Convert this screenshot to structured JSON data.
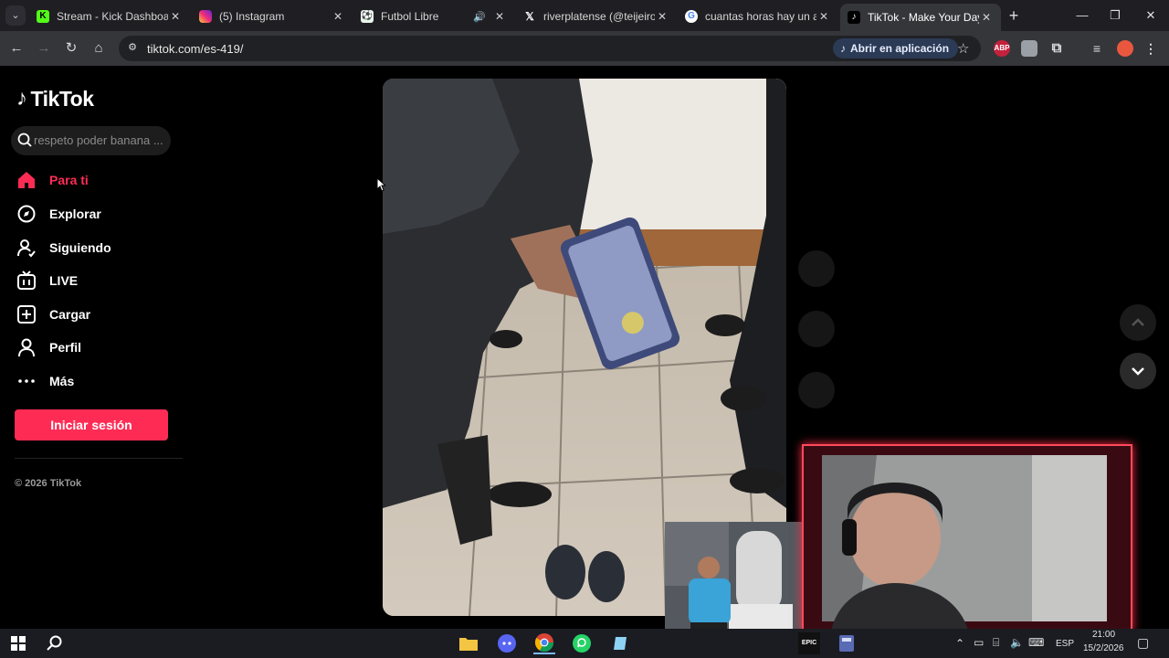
{
  "browser": {
    "tabs": [
      {
        "title": "Stream - Kick Dashboard",
        "favicon": "kick-icon",
        "active": false
      },
      {
        "title": "(5) Instagram",
        "favicon": "instagram-icon",
        "active": false
      },
      {
        "title": "Futbol Libre",
        "favicon": "futbol-libre-icon",
        "active": false,
        "audio": true
      },
      {
        "title": "riverplatense (@teijeiroant",
        "favicon": "x-icon",
        "active": false
      },
      {
        "title": "cuantas horas hay un año",
        "favicon": "google-icon",
        "active": false
      },
      {
        "title": "TikTok - Make Your Day",
        "favicon": "tiktok-icon",
        "active": true
      }
    ],
    "url": "tiktok.com/es-419/",
    "open_in_app_label": "Abrir en aplicación",
    "extension_abp_label": "ABP"
  },
  "tiktok": {
    "logo_text": "TikTok",
    "search_placeholder": "respeto poder banana ...",
    "nav": [
      {
        "label": "Para ti",
        "icon": "home-icon",
        "active": true
      },
      {
        "label": "Explorar",
        "icon": "compass-icon",
        "active": false
      },
      {
        "label": "Siguiendo",
        "icon": "user-follow-icon",
        "active": false
      },
      {
        "label": "LIVE",
        "icon": "live-tv-icon",
        "active": false
      },
      {
        "label": "Cargar",
        "icon": "upload-plus-icon",
        "active": false
      },
      {
        "label": "Perfil",
        "icon": "profile-icon",
        "active": false
      },
      {
        "label": "Más",
        "icon": "more-dots-icon",
        "active": false
      }
    ],
    "login_label": "Iniciar sesión",
    "copyright": "© 2026 TikTok"
  },
  "taskbar": {
    "language": "ESP",
    "time": "21:00",
    "date": "15/2/2026"
  },
  "colors": {
    "accent": "#fe2c55",
    "chrome_bg": "#1f1f23",
    "toolbar_bg": "#35363a",
    "overlay_frame": "#ff4a5c"
  }
}
